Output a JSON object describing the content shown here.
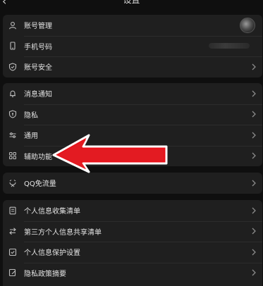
{
  "header": {
    "title": "设置",
    "back_icon": "chevron-left-icon"
  },
  "groups": [
    {
      "rows": [
        {
          "icon": "user-icon",
          "label": "账号管理",
          "trailing": "avatar"
        },
        {
          "icon": "phone-icon",
          "label": "手机号码",
          "trailing": "hidden-number"
        },
        {
          "icon": "shield-check-icon",
          "label": "账号安全",
          "trailing": "chevron"
        }
      ]
    },
    {
      "rows": [
        {
          "icon": "bell-icon",
          "label": "消息通知",
          "trailing": "chevron"
        },
        {
          "icon": "privacy-shield-icon",
          "label": "隐私",
          "trailing": "chevron"
        },
        {
          "icon": "sliders-icon",
          "label": "通用",
          "trailing": "chevron"
        },
        {
          "icon": "grid-icon",
          "label": "辅助功能",
          "trailing": "chevron"
        }
      ]
    },
    {
      "rows": [
        {
          "icon": "data-traffic-icon",
          "label": "QQ免流量",
          "trailing": "chevron"
        }
      ]
    },
    {
      "rows": [
        {
          "icon": "document-list-icon",
          "label": "个人信息收集清单",
          "trailing": "chevron"
        },
        {
          "icon": "share-swap-icon",
          "label": "第三方个人信息共享清单",
          "trailing": "chevron"
        },
        {
          "icon": "checkbox-icon",
          "label": "个人信息保护设置",
          "trailing": "chevron"
        },
        {
          "icon": "edit-document-icon",
          "label": "隐私政策摘要",
          "trailing": "chevron"
        }
      ]
    }
  ],
  "annotation": {
    "arrow_color": "#e8121a",
    "points_to": "辅助功能"
  }
}
